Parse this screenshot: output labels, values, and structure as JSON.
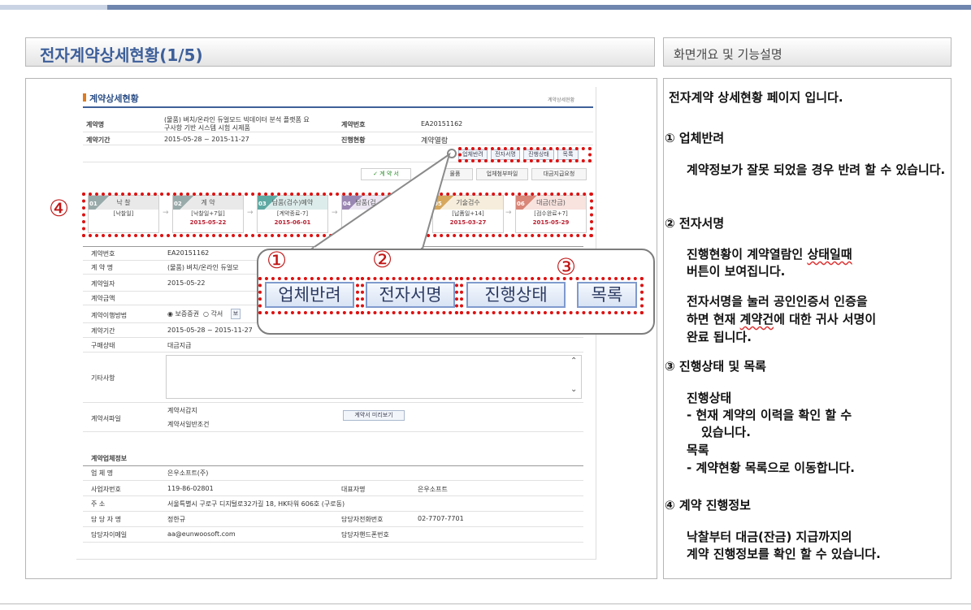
{
  "page_title": "전자계약상세현황(1/5)",
  "right_title": "화면개요 및 기능설명",
  "description": {
    "intro": "전자계약 상세현황 페이지 입니다.",
    "item1_title": "① 업체반려",
    "item1_body": "계약정보가 잘못 되었을 경우 반려 할 수 있습니다.",
    "item2_title": "② 전자서명",
    "item2_body_a1": "진행현황이 계약열람인 ",
    "item2_body_a2": "상태일때",
    "item2_body_a3": "버튼이 보여집니다.",
    "item2_body_b1": "전자서명을 눌러 공인인증서 인증을",
    "item2_body_b2": "하면 현재 ",
    "item2_body_b3": "계약건",
    "item2_body_b4": "에 대한 귀사 서명이",
    "item2_body_b5": "완료 됩니다.",
    "item3_title": "③ 진행상태 및 목록",
    "item3_sub1": "진행상태",
    "item3_sub1_body_a": "- 현재 계약의 이력을 확인 할 수",
    "item3_sub1_body_b": "있습니다.",
    "item3_sub2": "목록",
    "item3_sub2_body": "- 계약현황 목록으로 이동합니다.",
    "item4_title": "④ 계약 진행정보",
    "item4_body_a": "낙찰부터 대금(잔금) 지급까지의",
    "item4_body_b": "계약 진행정보를 확인 할 수 있습니다."
  },
  "markers": {
    "m1": "①",
    "m2": "②",
    "m3": "③",
    "m4": "④"
  },
  "big_buttons": {
    "reject": "업체반려",
    "sign": "전자서명",
    "status": "진행상태",
    "list": "목록"
  },
  "screenshot": {
    "header_title": "계약상세현황",
    "breadcrumb": "계약상세현황",
    "summary": {
      "name_label": "계약명",
      "name_value_a": "(물품) 벼치/온라인 듀얼모드 빅데이터 분석 플랫폼 요",
      "name_value_b": "구사항 기반 시스템 시험 시제품",
      "no_label": "계약번호",
      "no_value": "EA20151162",
      "period_label": "계약기간",
      "period_value": "2015-05-28 ~ 2015-11-27",
      "status_label": "진행현황",
      "status_value": "계약열람"
    },
    "buttons": {
      "reject": "업체반려",
      "sign": "전자서명",
      "status": "진행상태",
      "list": "목록"
    },
    "tabs": {
      "contract": "✓ 계 약 서",
      "goods": "물품",
      "attach": "업체첨부파일",
      "payment": "대금지급요청"
    },
    "steps": [
      {
        "num": "01",
        "name": "낙 찰",
        "line1": "[낙찰일]",
        "date": ""
      },
      {
        "num": "02",
        "name": "계 약",
        "line1": "[낙찰일+7일]",
        "date": "2015-05-22"
      },
      {
        "num": "03",
        "name": "납품(검수)예약",
        "line1": "[계약종료-7]",
        "date": "2015-06-01"
      },
      {
        "num": "04",
        "name": "납품(검",
        "line1": "",
        "date": ""
      },
      {
        "num": "05",
        "name": "기술검수",
        "line1": "[납품일+14]",
        "date": "2015-03-27"
      },
      {
        "num": "06",
        "name": "대금(잔금)",
        "line1": "[검수완료+7]",
        "date": "2015-05-29"
      }
    ],
    "detail": {
      "no_label": "계약번호",
      "no_value": "EA20151162",
      "name_label": "계 약 명",
      "name_value": "(물품) 벼치/온라인 듀얼모",
      "date_label": "계약일자",
      "date_value": "2015-05-22",
      "amount_label": "계약금액",
      "method_label": "계약이행방법",
      "method_opt1": "보증증권",
      "method_opt2": "각서",
      "method_btn": "보",
      "period_label": "계약기간",
      "period_value": "2015-05-28 ~ 2015-11-27",
      "buy_label": "구매상태",
      "buy_value": "대금지급",
      "etc_label": "기타사항",
      "file_label": "계약서파일",
      "file1": "계약서갑지",
      "file2": "계약서일반조건",
      "preview_btn": "계약서 미리보기"
    },
    "company": {
      "section_title": "계약업체정보",
      "name_label": "업 체 명",
      "name_value": "은우소프트(주)",
      "bizno_label": "사업자번호",
      "bizno_value": "119-86-02801",
      "ceo_label": "대표자명",
      "ceo_value": "은우소프트",
      "addr_label": "주 소",
      "addr_value": "서울특별시 구로구 디지털로32가길 18, HK타워 606호 (구로동)",
      "mgr_label": "담 당 자 명",
      "mgr_value": "정한규",
      "tel_label": "담당자전화번호",
      "tel_value": "02-7707-7701",
      "email_label": "담당자이메일",
      "email_value": "aa@eunwoosoft.com",
      "mobile_label": "담당자핸드폰번호"
    }
  }
}
